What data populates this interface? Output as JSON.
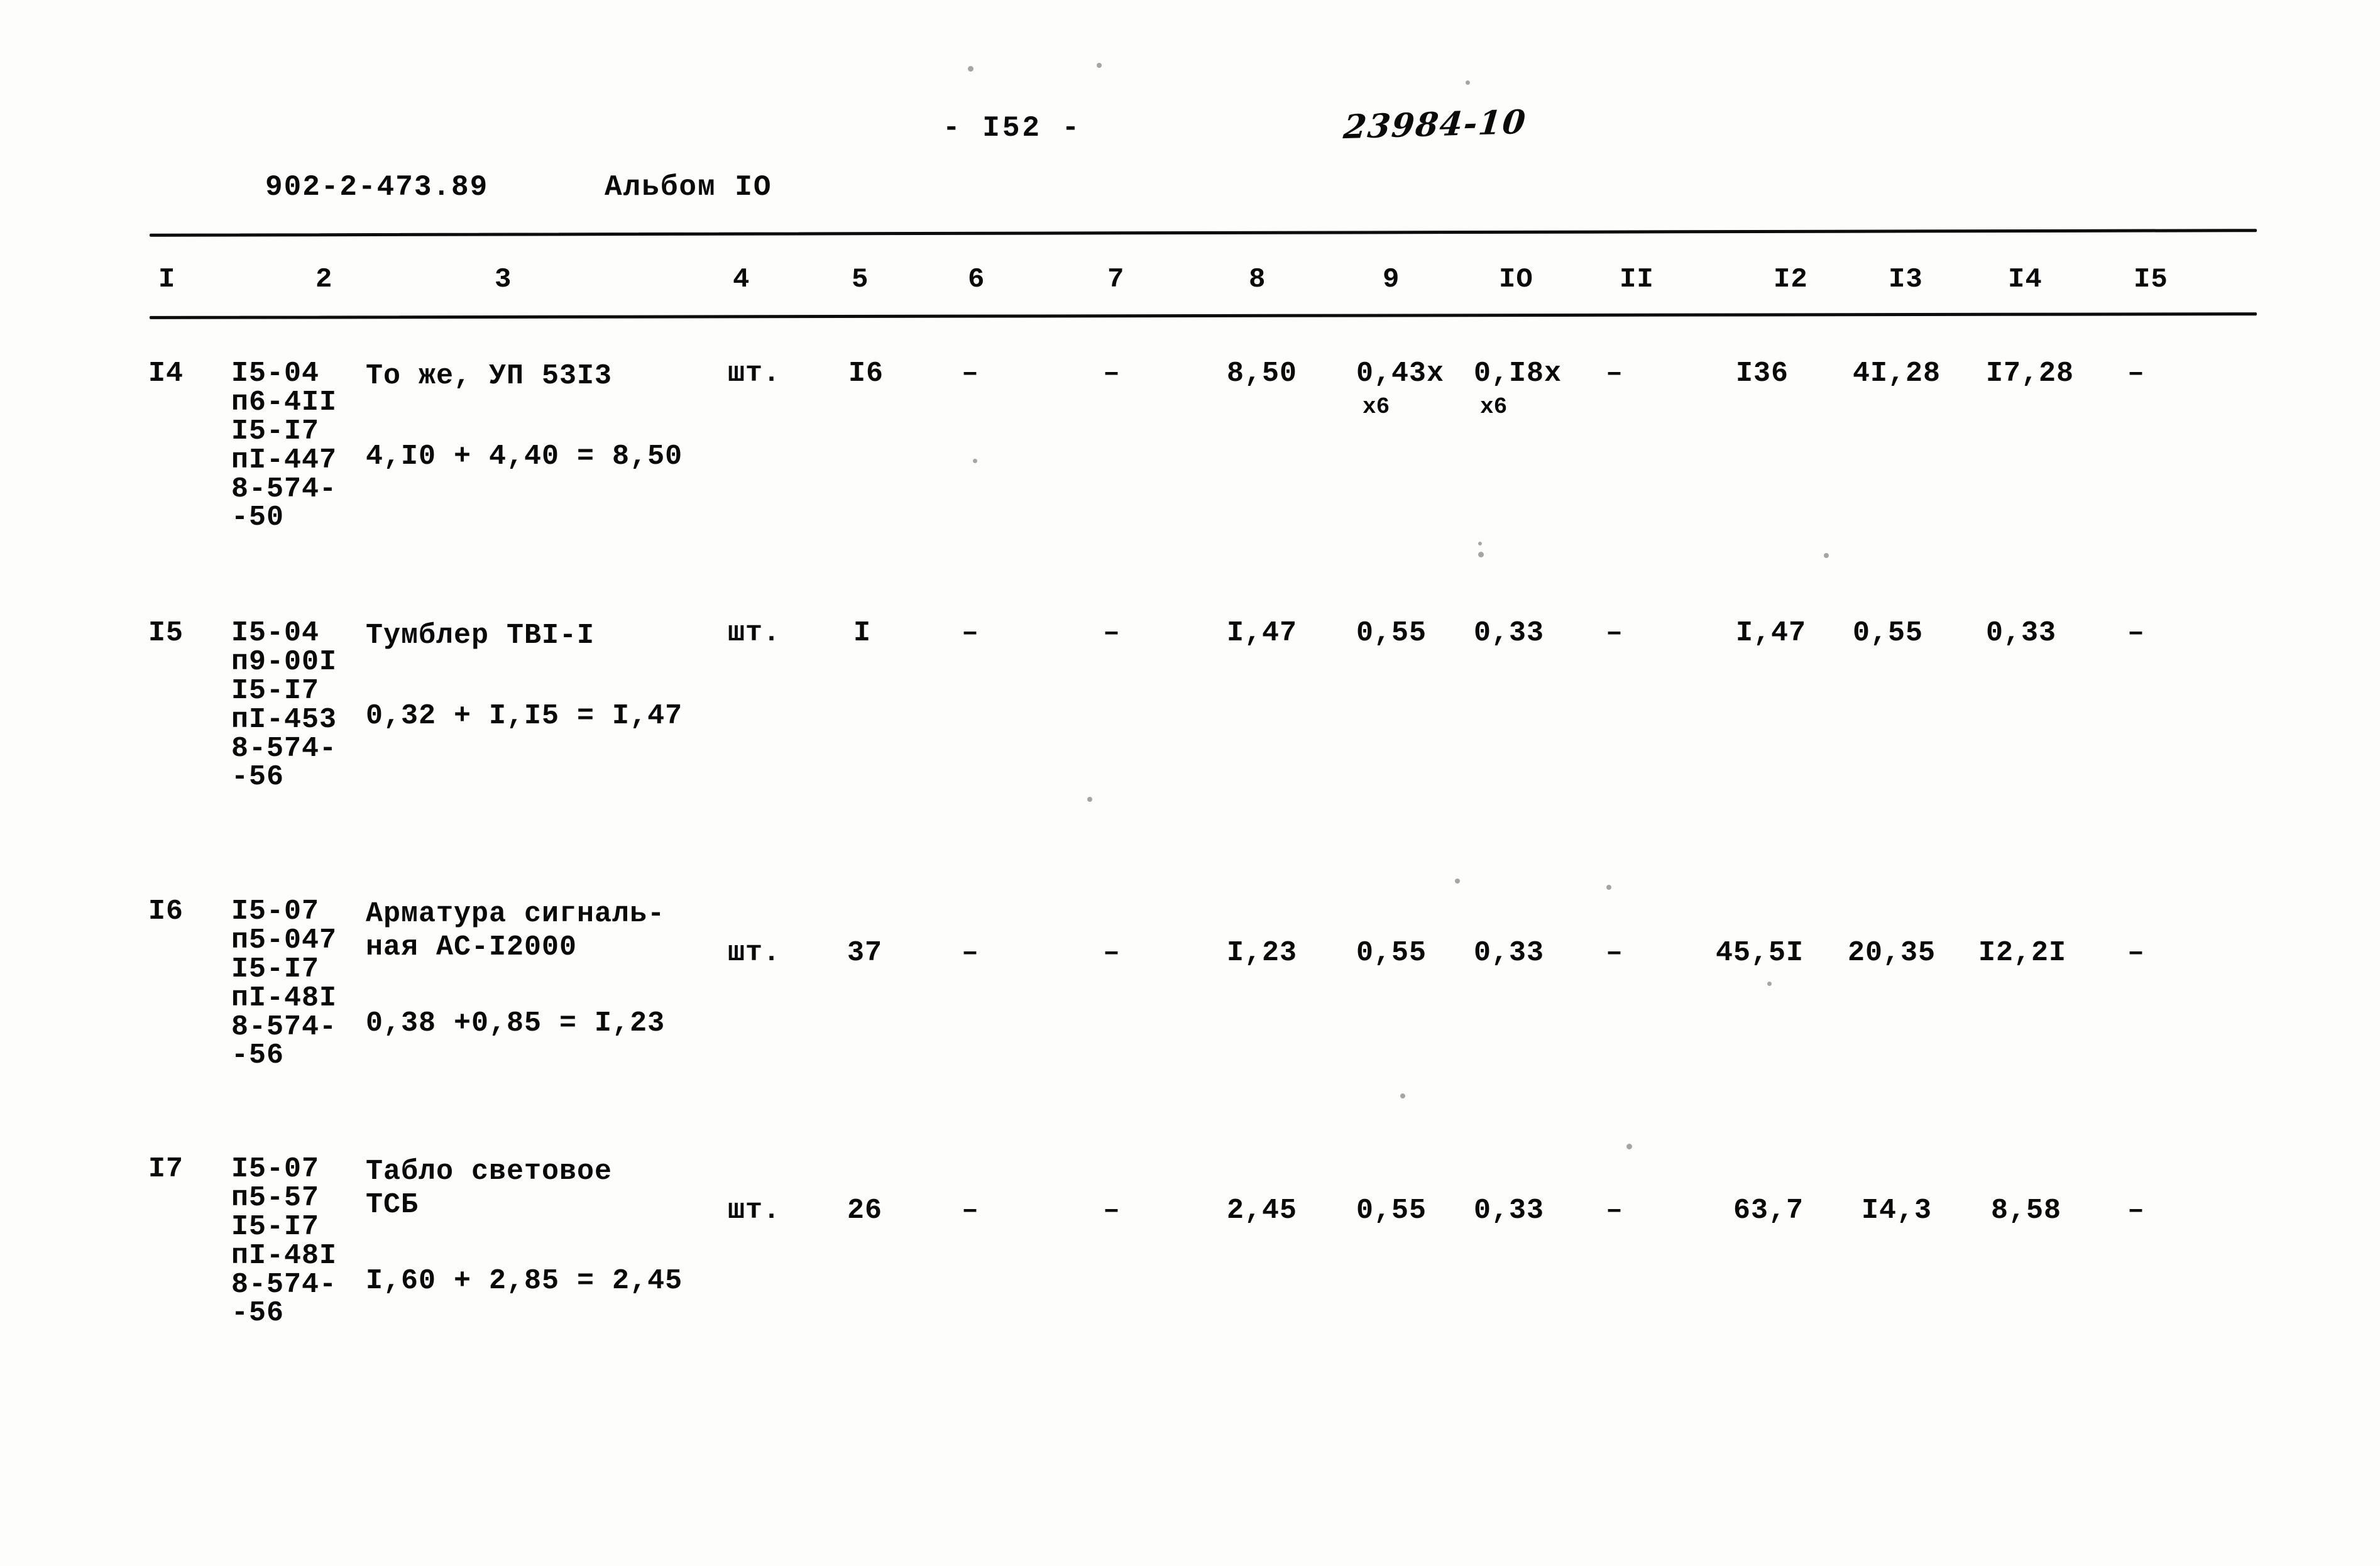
{
  "header": {
    "page_number": "- I52 -",
    "handwritten_ref": "23984-10",
    "album_code": "902-2-473.89",
    "album_name": "Альбом IO"
  },
  "table": {
    "column_headers": [
      "I",
      "2",
      "3",
      "4",
      "5",
      "6",
      "7",
      "8",
      "9",
      "IO",
      "II",
      "I2",
      "I3",
      "I4",
      "I5"
    ],
    "rows": [
      {
        "num": "I4",
        "code": "I5-04\nп6-4II\nI5-I7\nпI-447\n8-574-\n -50",
        "name": "То же, УП 53I3",
        "formula": "4,I0 + 4,40 = 8,50",
        "unit": "шт.",
        "qty": "I6",
        "c6": "–",
        "c7": "–",
        "c8": "8,50",
        "c9": "0,43х",
        "c9_sub": "х6",
        "c10": "0,I8х",
        "c10_sub": "х6",
        "c11": "–",
        "c12": "I36",
        "c13": "4I,28",
        "c14": "I7,28",
        "c15": "–"
      },
      {
        "num": "I5",
        "code": "I5-04\nп9-00I\nI5-I7\nпI-453\n8-574-\n -56",
        "name": "Тумблер ТВI-I",
        "formula": "0,32 + I,I5 = I,47",
        "unit": "шт.",
        "qty": "I",
        "c6": "–",
        "c7": "–",
        "c8": "I,47",
        "c9": "0,55",
        "c9_sub": "",
        "c10": "0,33",
        "c10_sub": "",
        "c11": "–",
        "c12": "I,47",
        "c13": "0,55",
        "c14": "0,33",
        "c15": "–"
      },
      {
        "num": "I6",
        "code": "I5-07\nп5-047\nI5-I7\nпI-48I\n8-574-\n -56",
        "name": "Арматура сигналь-\nная АС-I2000",
        "formula": "0,38 +0,85 = I,23",
        "unit": "шт.",
        "qty": "37",
        "c6": "–",
        "c7": "–",
        "c8": "I,23",
        "c9": "0,55",
        "c9_sub": "",
        "c10": "0,33",
        "c10_sub": "",
        "c11": "–",
        "c12": "45,5I",
        "c13": "20,35",
        "c14": "I2,2I",
        "c15": "–"
      },
      {
        "num": "I7",
        "code": "I5-07\nп5-57\nI5-I7\nпI-48I\n8-574-\n -56",
        "name": "Табло световое\nТСБ",
        "formula": "I,60 + 2,85 = 2,45",
        "unit": "шт.",
        "qty": "26",
        "c6": "–",
        "c7": "–",
        "c8": "2,45",
        "c9": "0,55",
        "c9_sub": "",
        "c10": "0,33",
        "c10_sub": "",
        "c11": "–",
        "c12": "63,7",
        "c13": "I4,3",
        "c14": "8,58",
        "c15": "–"
      }
    ]
  }
}
